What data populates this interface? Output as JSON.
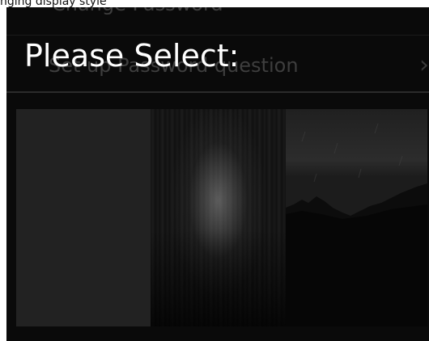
{
  "page": {
    "caption": "nging display style"
  },
  "background_list": {
    "item1": "Change Password",
    "item2": "Set up Password question",
    "chevron": "›"
  },
  "dialog": {
    "title": "Please Select:",
    "options": [
      {
        "name": "solid-dark-gray",
        "color": "#222222"
      },
      {
        "name": "wood-texture-spotlight",
        "color": "#141414"
      },
      {
        "name": "night-mountain-landscape",
        "color": "#050505"
      }
    ]
  }
}
